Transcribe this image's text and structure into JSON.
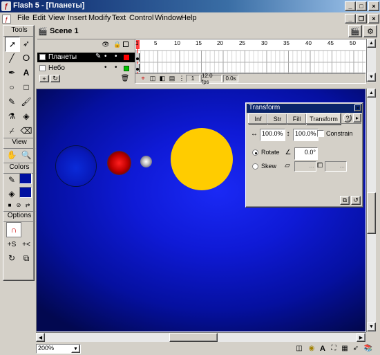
{
  "window": {
    "title": "Flash 5 - [Планеты]",
    "min": "_",
    "max": "□",
    "close": "×"
  },
  "menu": [
    "File",
    "Edit",
    "View",
    "Insert",
    "Modify",
    "Text",
    "Control",
    "Window",
    "Help"
  ],
  "tools": {
    "header": "Tools",
    "view_header": "View",
    "colors_header": "Colors",
    "options_header": "Options"
  },
  "scene": {
    "label": "Scene 1"
  },
  "timeline": {
    "layers": [
      {
        "name": "Планеты",
        "color": "#ff0000"
      },
      {
        "name": "Небо",
        "color": "#00c000"
      }
    ],
    "frame_numbers": [
      "1",
      "5",
      "10",
      "15",
      "20",
      "25",
      "30",
      "35",
      "40",
      "45",
      "50"
    ],
    "current_frame": "1",
    "fps": "12.0 fps",
    "time": "0.0s"
  },
  "stage": {
    "planets": [
      {
        "name": "planet-blue",
        "color": "#0000cc"
      },
      {
        "name": "planet-red",
        "color": "#cc0000"
      },
      {
        "name": "planet-white",
        "color": "#ffffff"
      },
      {
        "name": "sun",
        "color": "#ffcc00"
      }
    ]
  },
  "transform_panel": {
    "title": "Transform",
    "tabs": [
      "Inf",
      "Str",
      "Fill",
      "Transform"
    ],
    "width": "100.0%",
    "height": "100.0%",
    "constrain": "Constrain",
    "rotate_label": "Rotate",
    "rotate_value": "0.0°",
    "skew_label": "Skew",
    "skew_h": "...",
    "skew_v": "..."
  },
  "status": {
    "zoom": "200%"
  },
  "colors": {
    "titlebar": "#0a246a",
    "stage": "#0f1ad6",
    "chrome": "#d4d0c8"
  }
}
